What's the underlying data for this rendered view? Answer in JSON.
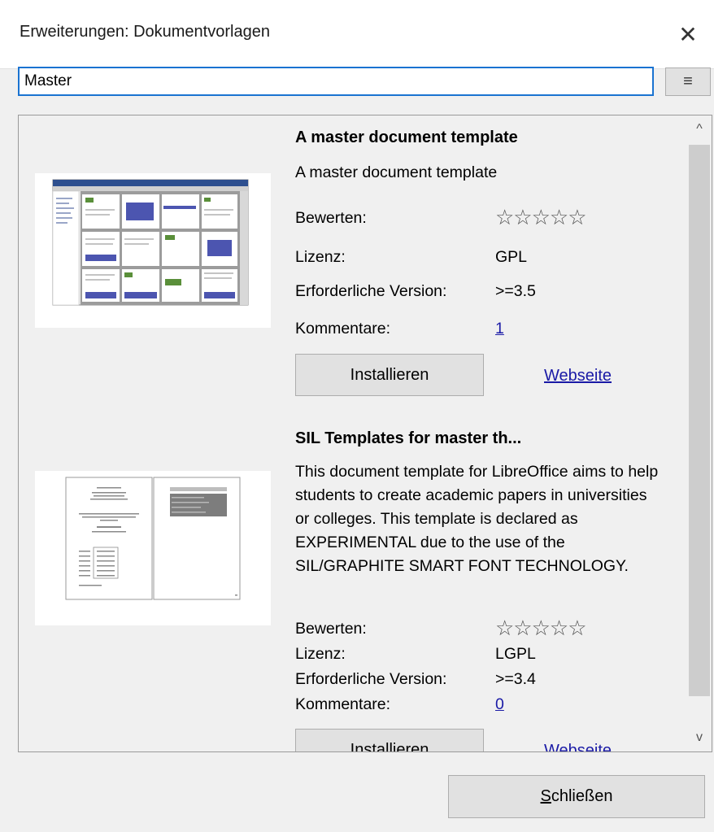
{
  "window": {
    "title": "Erweiterungen: Dokumentvorlagen",
    "close_glyph": "✕"
  },
  "search": {
    "value": "Master",
    "menu_glyph": "≡"
  },
  "labels": {
    "rating": "Bewerten:",
    "license": "Lizenz:",
    "required_version": "Erforderliche Version:",
    "comments": "Kommentare:"
  },
  "entries": [
    {
      "name": "A master document template",
      "description": "A master document template",
      "rating_stars": "☆☆☆☆☆",
      "rating": 0,
      "license": "GPL",
      "version": ">=3.5",
      "comments": "1",
      "install_label": "Installieren",
      "website_label": "Webseite"
    },
    {
      "name": "SIL Templates for master th...",
      "description": "This document template for LibreOffice aims to help students to create academic papers in universities or colleges. This template is declared as EXPERIMENTAL due to the use of the SIL/GRAPHITE SMART FONT TECHNOLOGY.",
      "rating_stars": "☆☆☆☆☆",
      "rating": 0,
      "license": "LGPL",
      "version": ">=3.4",
      "comments": "0",
      "install_label": "Installieren",
      "website_label": "Webseite"
    }
  ],
  "scrollbar": {
    "up_glyph": "^",
    "down_glyph": "v"
  },
  "footer": {
    "close_mnemonic": "S",
    "close_rest": "chließen"
  },
  "colors": {
    "accent": "#1a73d1",
    "link": "#1a1aa6",
    "button_bg": "#e1e1e1",
    "dialog_bg": "#f0f0f0"
  },
  "icons": {
    "close": "close-icon",
    "menu": "hamburger-menu-icon",
    "star": "star-icon"
  }
}
